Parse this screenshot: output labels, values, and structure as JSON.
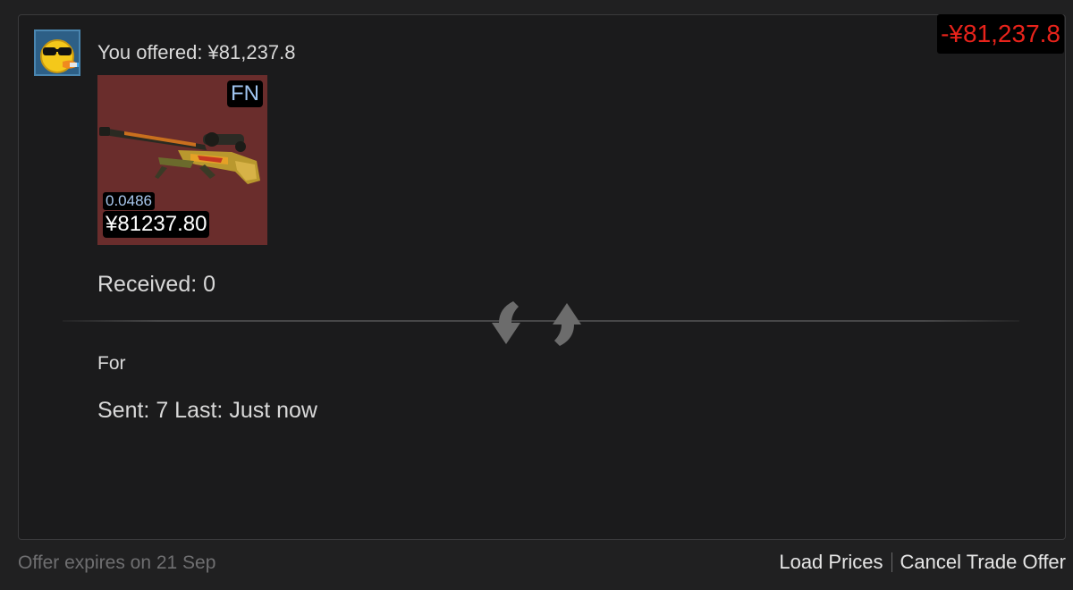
{
  "offer": {
    "offered_label": "You offered: ¥81,237.8",
    "total_delta": "-¥81,237.8",
    "item": {
      "wear": "FN",
      "float": "0.0486",
      "price": "¥81237.80"
    },
    "received_label": "Received: 0",
    "for_label": "For",
    "sent_label": "Sent: 7 Last: Just now"
  },
  "footer": {
    "expires": "Offer expires on 21 Sep",
    "load_prices": "Load Prices",
    "cancel_offer": "Cancel Trade Offer"
  },
  "colors": {
    "background": "#202021",
    "panel": "#1b1b1c",
    "negative": "#e8231b",
    "item_tile": "#6a2d2c",
    "wear_text": "#9fc4f0"
  },
  "icons": {
    "avatar": "duck-with-sunglasses-avatar",
    "swap": "trade-swap-arrows-icon",
    "item_image": "sniper-rifle-icon"
  }
}
